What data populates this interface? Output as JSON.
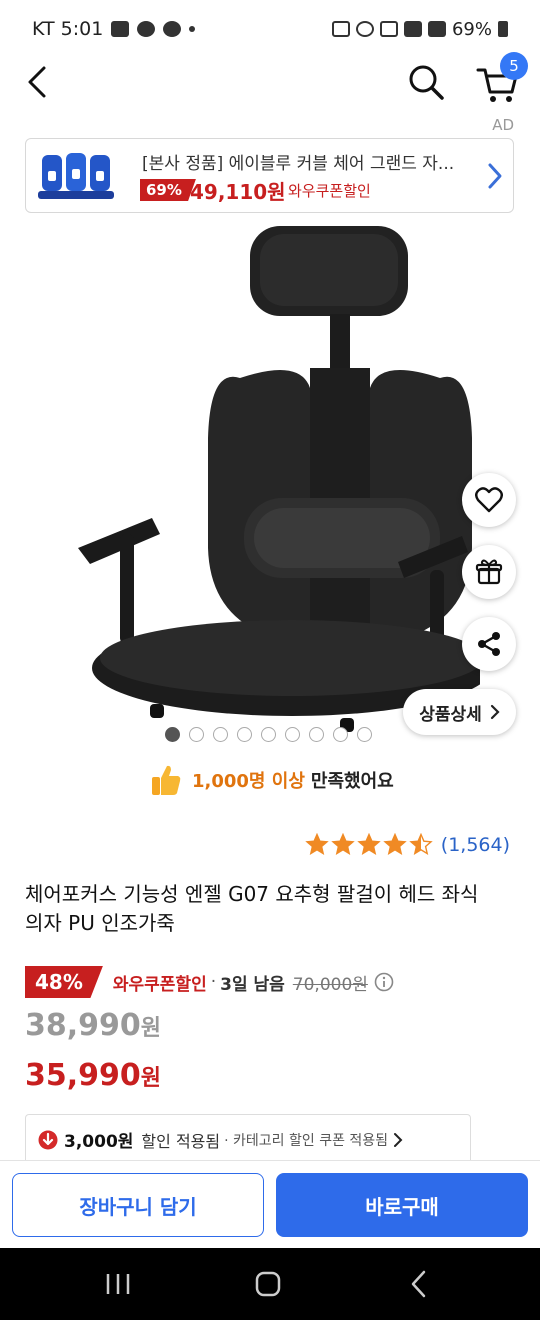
{
  "status": {
    "carrier_time": "KT 5:01",
    "battery": "69%"
  },
  "header": {
    "cart_count": "5"
  },
  "ad": {
    "label": "AD",
    "title": "[본사 정품] 에이블루 커블 체어 그랜드 자...",
    "discount": "69%",
    "price": "49,110원",
    "coupon": "와우쿠폰할인"
  },
  "product": {
    "detail_label": "상품상세",
    "satisfaction_highlight": "1,000명 이상",
    "satisfaction_text": "만족했어요",
    "rating_value": 4.5,
    "rating_count": "(1,564)",
    "title": "체어포커스 기능성 엔젤 G07 요추형 팔걸이 헤드 좌식의자 PU 인조가죽",
    "image_count": 9,
    "image_index": 1
  },
  "price": {
    "discount": "48%",
    "coupon_label": "와우쿠폰할인",
    "sep": "·",
    "days_left": "3일 남음",
    "original": "70,000원",
    "sale_number": "38,990",
    "final_number": "35,990",
    "unit": "원",
    "benefit_amount": "3,000원",
    "benefit_text": "할인 적용됨",
    "benefit_category": "· 카테고리 할인 쿠폰 적용됨"
  },
  "actions": {
    "add_to_cart": "장바구니 담기",
    "buy_now": "바로구매"
  },
  "colors": {
    "accent_blue": "#2e6bea",
    "sale_red": "#c71f1f",
    "rating_orange": "#f08a24"
  }
}
